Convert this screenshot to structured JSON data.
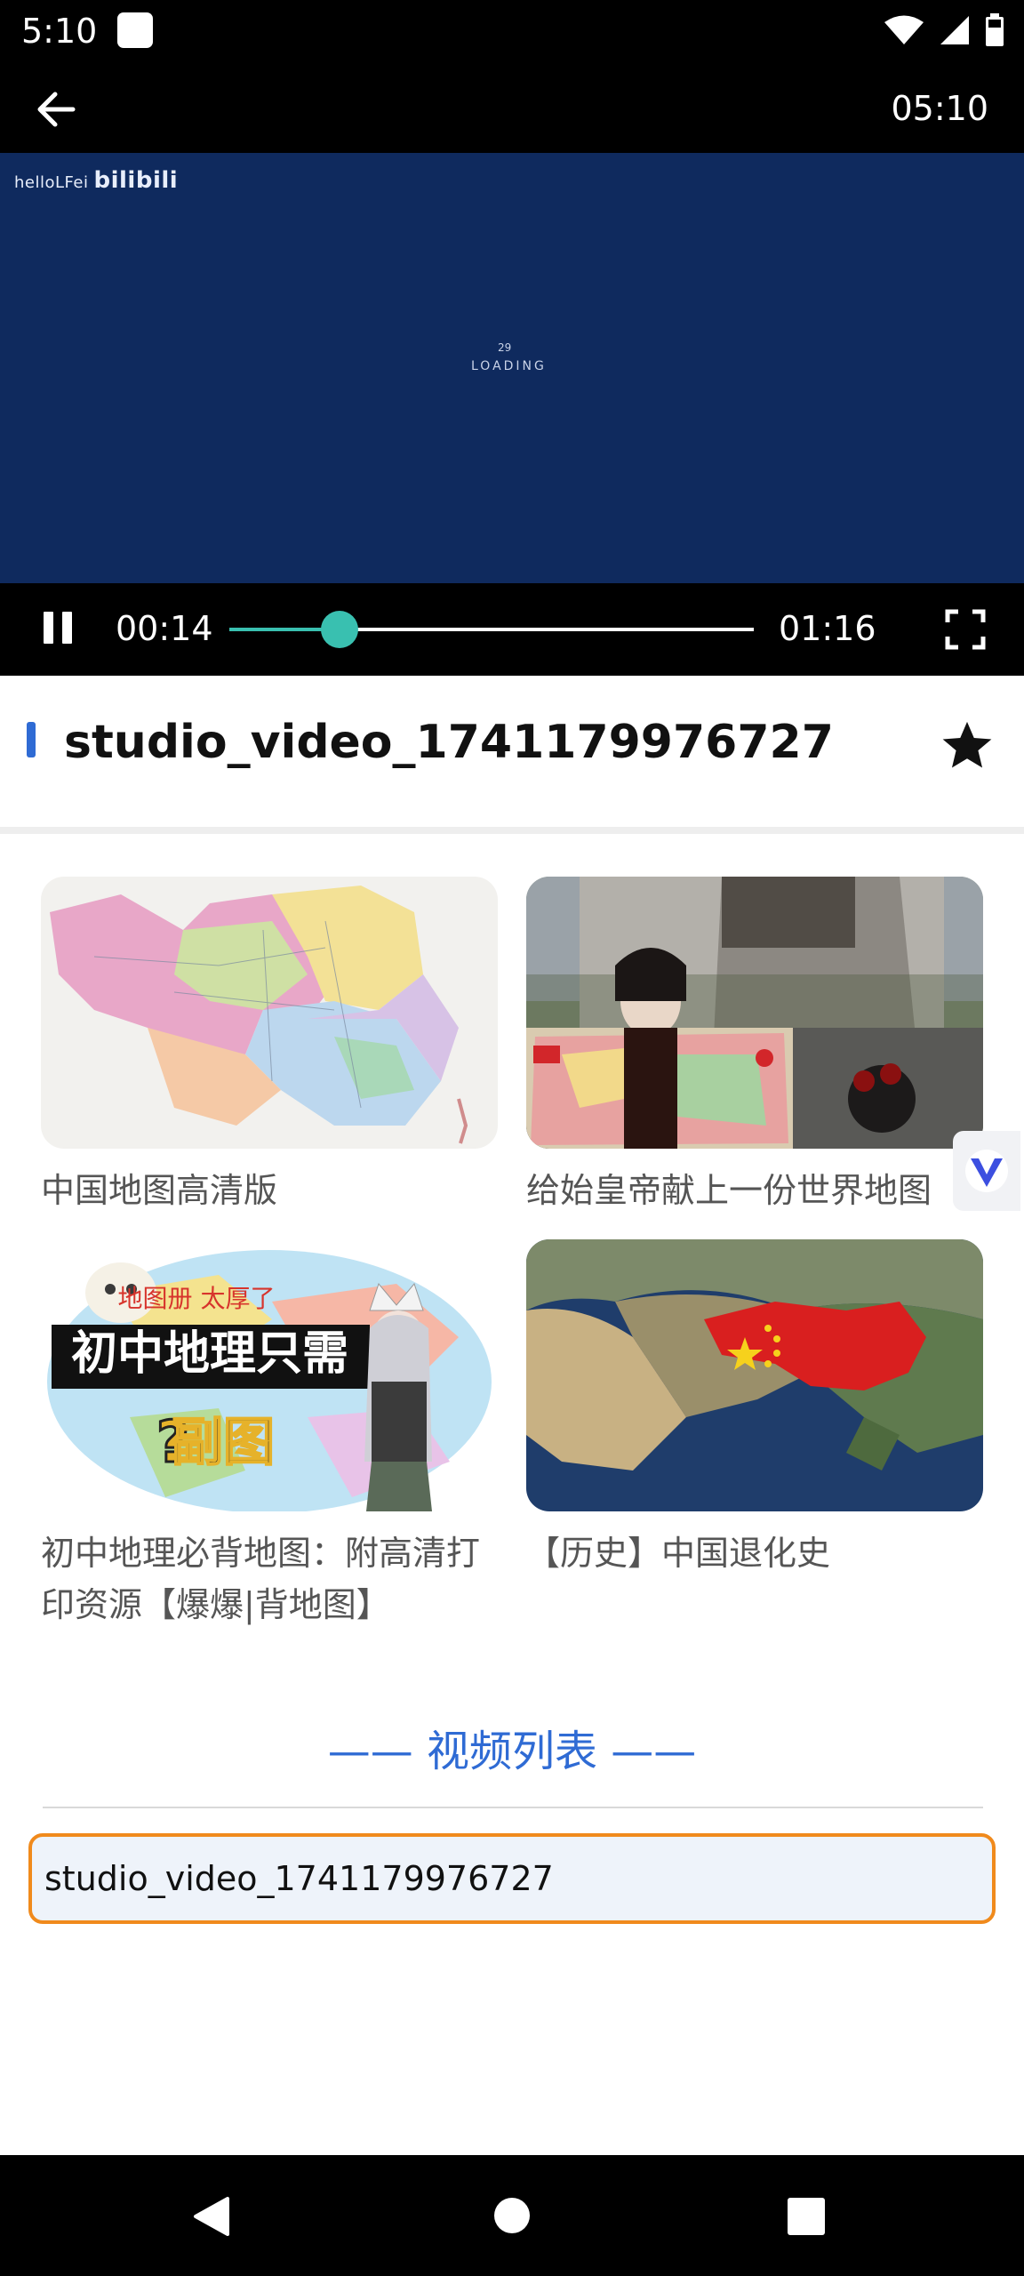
{
  "status_bar": {
    "time": "5:10"
  },
  "player": {
    "clock": "05:10",
    "watermark_user": "helloLFei",
    "watermark_logo": "bilibili",
    "loading_percent": "29",
    "loading_label": "LOADING",
    "current_time": "00:14",
    "total_time": "01:16",
    "progress": 0.21,
    "accent_color": "#39c0b0"
  },
  "video": {
    "title": "studio_video_1741179976727"
  },
  "recommendations": [
    {
      "title": "中国地图高清版"
    },
    {
      "title": "给始皇帝献上一份世界地图"
    },
    {
      "title": "初中地理必背地图：附高清打印资源【爆爆|背地图】",
      "overlay_top": "地图册 太厚了",
      "overlay_main": "初中地理只需",
      "overlay_sub": "副图"
    },
    {
      "title": "【历史】中国退化史"
    }
  ],
  "video_list": {
    "heading": "—— 视频列表 ——",
    "items": [
      "studio_video_1741179976727"
    ]
  }
}
